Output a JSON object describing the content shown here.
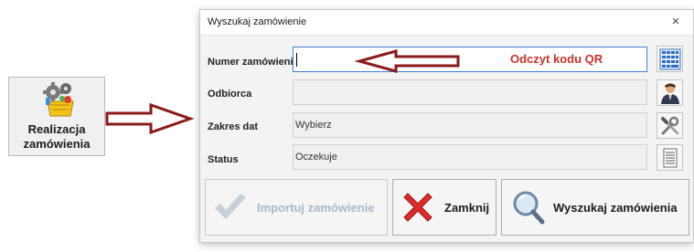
{
  "launcher": {
    "label": "Realizacja\nzamówienia"
  },
  "dialog": {
    "title": "Wyszukaj zamówienie",
    "close_glyph": "×",
    "fields": {
      "order_number": {
        "label": "Numer zamówienia",
        "value": ""
      },
      "recipient": {
        "label": "Odbiorca",
        "value": ""
      },
      "date_range": {
        "label": "Zakres dat",
        "value": "Wybierz"
      },
      "status": {
        "label": "Status",
        "value": "Oczekuje"
      }
    },
    "qr_hint": "Odczyt kodu QR",
    "side_buttons": [
      "keypad-icon",
      "person-icon",
      "tools-icon",
      "list-icon"
    ],
    "buttons": {
      "import": {
        "label": "Importuj zamówienie",
        "enabled": false
      },
      "close": {
        "label": "Zamknij"
      },
      "search": {
        "label": "Wyszukaj zamówienia"
      }
    }
  },
  "colors": {
    "arrow": "#8b1a1a",
    "qr_hint": "#c9322a",
    "active_field_border": "#3f7fd0",
    "disabled_text": "#a8b8cc"
  }
}
